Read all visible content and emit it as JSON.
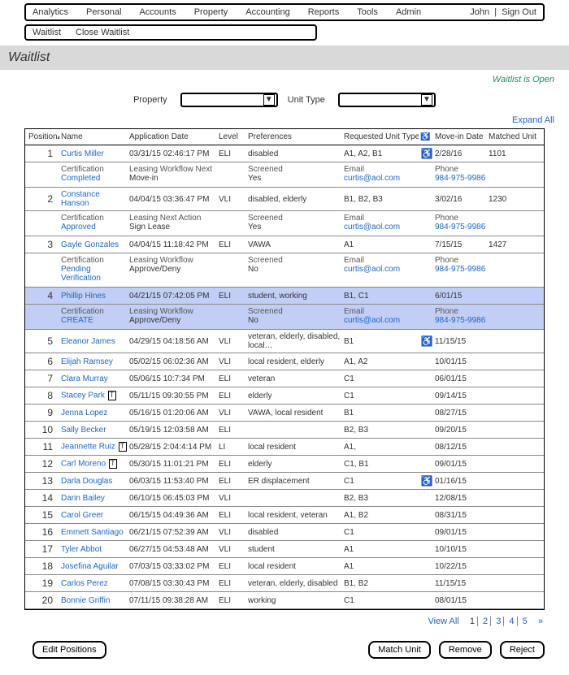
{
  "topnav": {
    "items": [
      "Analytics",
      "Personal",
      "Accounts",
      "Property",
      "Accounting",
      "Reports",
      "Tools",
      "Admin"
    ],
    "user": "John",
    "sign_out": "Sign Out"
  },
  "subbar": {
    "items": [
      "Waitlist",
      "Close Waitlist"
    ]
  },
  "banner_title": "Waitlist",
  "status_text": "Waitlist is Open",
  "filters": {
    "property_label": "Property",
    "unit_type_label": "Unit Type"
  },
  "expand_all": "Expand All",
  "columns": {
    "position": "Position",
    "name": "Name",
    "app_date": "Application Date",
    "level": "Level",
    "prefs": "Preferences",
    "req_type": "Requested Unit Type",
    "access": "",
    "movein": "Move-in Date",
    "matched": "Matched Unit"
  },
  "exp_labels": {
    "cert": "Certification",
    "leasing": "",
    "screened": "Screened",
    "email": "Email",
    "phone": "Phone"
  },
  "rows": [
    {
      "pos": "1",
      "name": "Curtis Miller",
      "app_date": "03/31/15 02:46:17 PM",
      "level": "ELI",
      "prefs": "disabled",
      "req": "A1, A2, B1",
      "access": true,
      "movein": "2/28/16",
      "matched": "1101",
      "cert_status": "Completed",
      "leasing_label": "Leasing Workflow Next",
      "leasing_value": "Move-in",
      "screened": "Yes",
      "email": "curtis@aol.com",
      "phone": "984-975-9986"
    },
    {
      "pos": "2",
      "name": "Constance Hanson",
      "app_date": "04/04/15 03:36:47 PM",
      "level": "VLI",
      "prefs": "disabled, elderly",
      "req": "B1, B2, B3",
      "access": false,
      "movein": "3/02/16",
      "matched": "1230",
      "cert_status": "Approved",
      "leasing_label": "Leasing Next Action",
      "leasing_value": "Sign Lease",
      "screened": "Yes",
      "email": "curtis@aol.com",
      "phone": "984-975-9986"
    },
    {
      "pos": "3",
      "name": "Gayle Gonzales",
      "app_date": "04/04/15 11:18:42 PM",
      "level": "ELI",
      "prefs": "VAWA",
      "req": "A1",
      "access": false,
      "movein": "7/15/15",
      "matched": "1427",
      "cert_status": "Pending Verification",
      "leasing_label": "Leasing Workflow",
      "leasing_value": "Approve/Deny",
      "screened": "No",
      "email": "curtis@aol.com",
      "phone": "984-975-9986"
    },
    {
      "pos": "4",
      "name": "Phillip Hines",
      "app_date": "04/21/15 07:42:05 PM",
      "level": "ELI",
      "prefs": "student, working",
      "req": "B1, C1",
      "access": false,
      "movein": "6/01/15",
      "matched": "",
      "cert_status": "CREATE",
      "leasing_label": "Leasing Workflow",
      "leasing_value": "Approve/Deny",
      "screened": "No",
      "email": "curtis@aol.com",
      "phone": "984-975-9986",
      "highlight": true
    },
    {
      "pos": "5",
      "name": "Eleanor James",
      "app_date": "04/29/15 04:18:56 AM",
      "level": "VLI",
      "prefs": "veteran, elderly, disabled, local…",
      "req": "B1",
      "access": true,
      "movein": "11/15/15",
      "matched": ""
    },
    {
      "pos": "6",
      "name": "Elijah Ramsey",
      "app_date": "05/02/15 06:02:36 AM",
      "level": "VLI",
      "prefs": "local resident, elderly",
      "req": "A1, A2",
      "access": false,
      "movein": "10/01/15",
      "matched": ""
    },
    {
      "pos": "7",
      "name": "Clara Murray",
      "app_date": "05/06/15 10:7:34 PM",
      "level": "ELI",
      "prefs": "veteran",
      "req": "C1",
      "access": false,
      "movein": "06/01/15",
      "matched": ""
    },
    {
      "pos": "8",
      "name": "Stacey Park",
      "note": true,
      "app_date": "05/11/15 09:30:55 PM",
      "level": "ELI",
      "prefs": "elderly",
      "req": "C1",
      "access": false,
      "movein": "09/14/15",
      "matched": ""
    },
    {
      "pos": "9",
      "name": "Jenna Lopez",
      "app_date": "05/16/15 01:20:06 AM",
      "level": "VLI",
      "prefs": "VAWA, local resident",
      "req": "B1",
      "access": false,
      "movein": "08/27/15",
      "matched": ""
    },
    {
      "pos": "10",
      "name": "Sally Becker",
      "app_date": "05/19/15 12:03:58 AM",
      "level": "ELI",
      "prefs": "",
      "req": "B2, B3",
      "access": false,
      "movein": "09/20/15",
      "matched": ""
    },
    {
      "pos": "11",
      "name": "Jeannette Ruiz",
      "note": true,
      "app_date": "05/28/15 2:04:4:14 PM",
      "level": "LI",
      "prefs": "local resident",
      "req": "A1,",
      "access": false,
      "movein": "08/12/15",
      "matched": ""
    },
    {
      "pos": "12",
      "name": "Carl Moreno",
      "note": true,
      "app_date": "05/30/15 11:01:21 PM",
      "level": "ELI",
      "prefs": "elderly",
      "req": "C1, B1",
      "access": false,
      "movein": "09/01/15",
      "matched": ""
    },
    {
      "pos": "13",
      "name": "Darla Douglas",
      "app_date": "06/03/15 11:53:40 PM",
      "level": "ELI",
      "prefs": "ER displacement",
      "req": "C1",
      "access": true,
      "movein": "01/16/15",
      "matched": ""
    },
    {
      "pos": "14",
      "name": "Darin Bailey",
      "app_date": "06/10/15 06:45:03 PM",
      "level": "VLI",
      "prefs": "",
      "req": "B2, B3",
      "access": false,
      "movein": "12/08/15",
      "matched": ""
    },
    {
      "pos": "15",
      "name": "Carol Greer",
      "app_date": "06/15/15 04:49:36 AM",
      "level": "ELI",
      "prefs": "local resident, veteran",
      "req": "A1, B2",
      "access": false,
      "movein": "08/31/15",
      "matched": ""
    },
    {
      "pos": "16",
      "name": "Emmett Santiago",
      "app_date": "06/21/15 07:52:39 AM",
      "level": "VLI",
      "prefs": "disabled",
      "req": "C1",
      "access": false,
      "movein": "09/01/15",
      "matched": ""
    },
    {
      "pos": "17",
      "name": "Tyler Abbot",
      "app_date": "06/27/15 04:53:48 AM",
      "level": "VLI",
      "prefs": "student",
      "req": "A1",
      "access": false,
      "movein": "10/10/15",
      "matched": ""
    },
    {
      "pos": "18",
      "name": "Josefina Aguilar",
      "app_date": "07/03/15 03:33:02 PM",
      "level": "ELI",
      "prefs": "local resident",
      "req": "A1",
      "access": false,
      "movein": "10/22/15",
      "matched": ""
    },
    {
      "pos": "19",
      "name": "Carlos Perez",
      "app_date": "07/08/15 03:30:43 PM",
      "level": "ELI",
      "prefs": "veteran, elderly, disabled",
      "req": "B1, B2",
      "access": false,
      "movein": "11/15/15",
      "matched": ""
    },
    {
      "pos": "20",
      "name": "Bonnie Griffin",
      "app_date": "07/11/15 09:38:28 AM",
      "level": "ELI",
      "prefs": "working",
      "req": "C1",
      "access": false,
      "movein": "08/01/15",
      "matched": ""
    }
  ],
  "pager": {
    "view_all": "View All",
    "pages": [
      "1",
      "2",
      "3",
      "4",
      "5"
    ],
    "next": "»"
  },
  "buttons": {
    "edit": "Edit Positions",
    "match": "Match Unit",
    "remove": "Remove",
    "reject": "Reject"
  }
}
